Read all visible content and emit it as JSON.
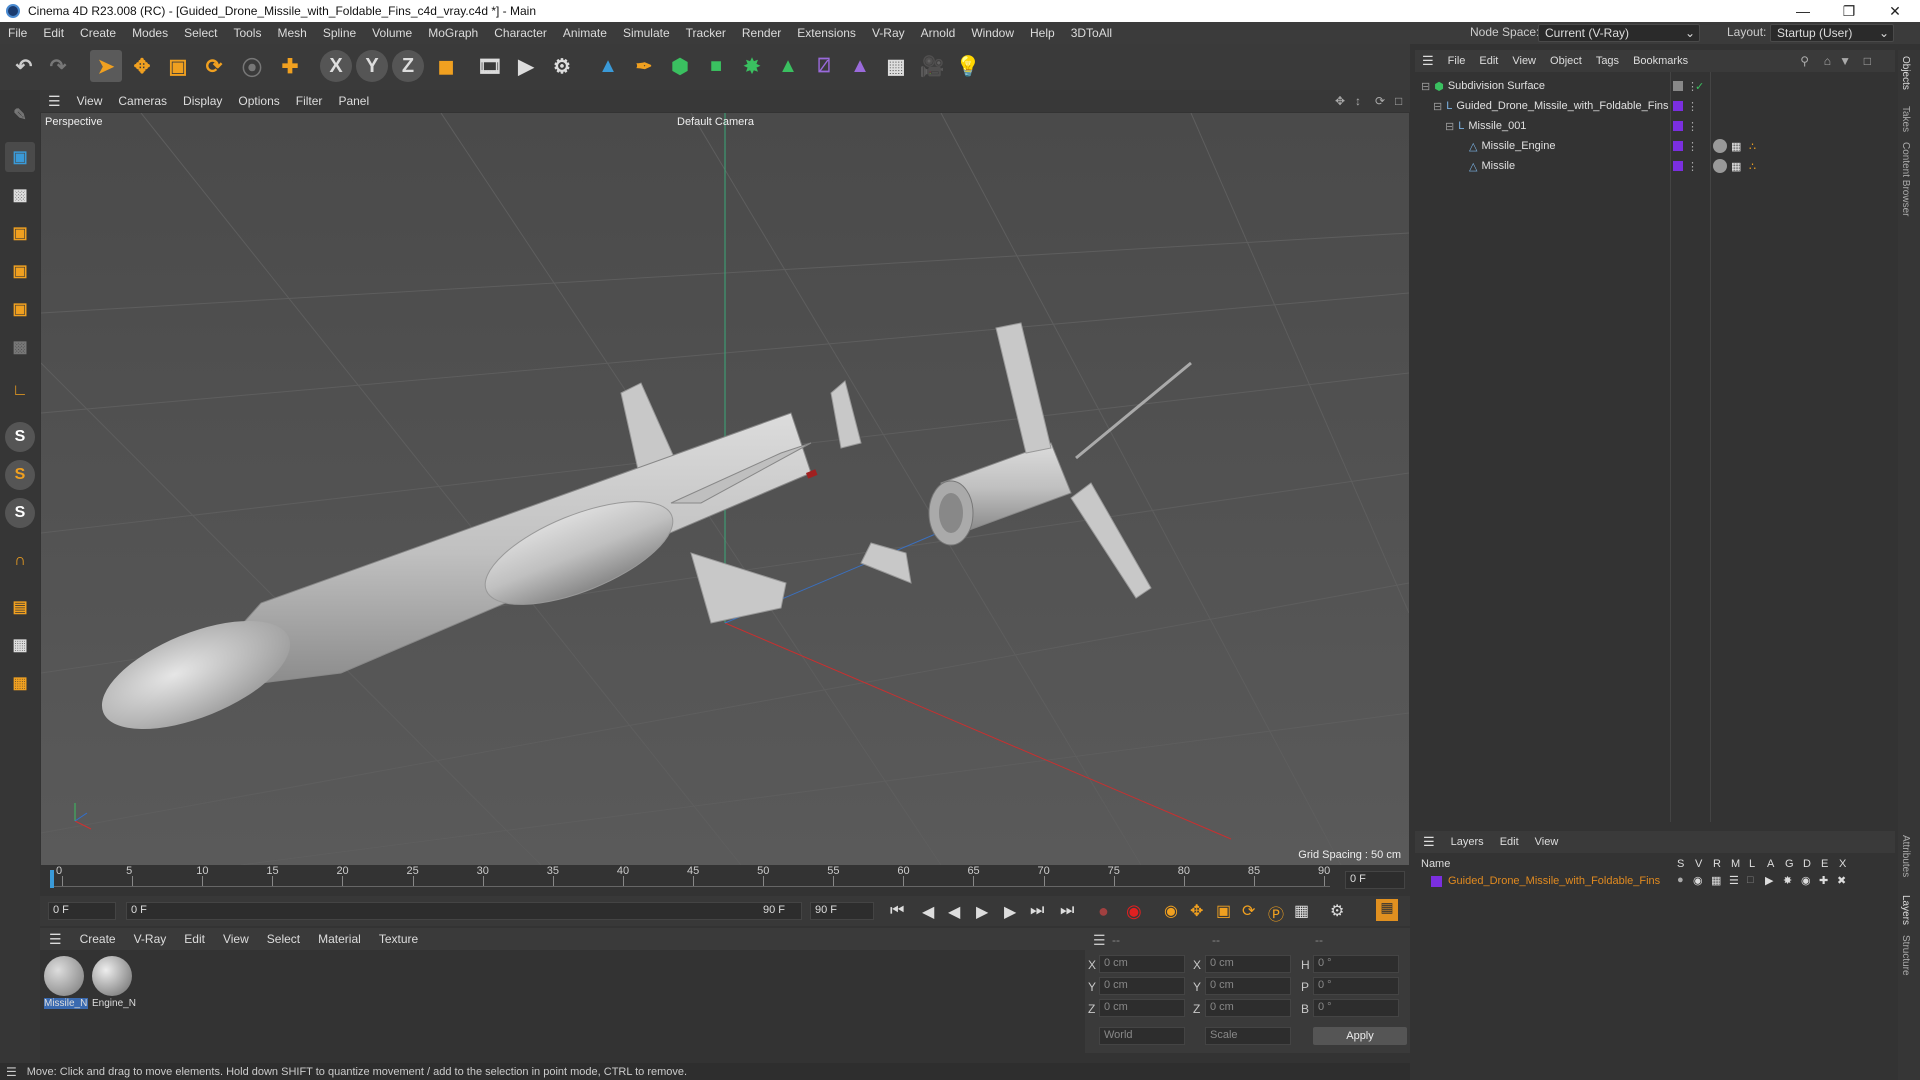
{
  "title": "Cinema 4D R23.008 (RC) - [Guided_Drone_Missile_with_Foldable_Fins_c4d_vray.c4d *] - Main",
  "menu": [
    "File",
    "Edit",
    "Create",
    "Modes",
    "Select",
    "Tools",
    "Mesh",
    "Spline",
    "Volume",
    "MoGraph",
    "Character",
    "Animate",
    "Simulate",
    "Tracker",
    "Render",
    "Extensions",
    "V-Ray",
    "Arnold",
    "Window",
    "Help",
    "3DToAll"
  ],
  "node_space_label": "Node Space:",
  "node_space_value": "Current (V-Ray)",
  "layout_label": "Layout:",
  "layout_value": "Startup (User)",
  "viewport_menu": [
    "View",
    "Cameras",
    "Display",
    "Options",
    "Filter",
    "Panel"
  ],
  "viewport": {
    "name": "Perspective",
    "camera": "Default Camera",
    "grid_spacing": "Grid Spacing : 50 cm"
  },
  "timeline": {
    "ticks": [
      "0",
      "5",
      "10",
      "15",
      "20",
      "25",
      "30",
      "35",
      "40",
      "45",
      "50",
      "55",
      "60",
      "65",
      "70",
      "75",
      "80",
      "85",
      "90"
    ],
    "current_frame": "0 F"
  },
  "transport": {
    "start": "0 F",
    "range_start": "0 F",
    "range_end": "90 F",
    "end": "90 F"
  },
  "material_menu": [
    "Create",
    "V-Ray",
    "Edit",
    "View",
    "Select",
    "Material",
    "Texture"
  ],
  "materials": [
    {
      "label": "Missile_N"
    },
    {
      "label": "Engine_N"
    }
  ],
  "coords": {
    "header": [
      "--",
      "--",
      "--"
    ],
    "rows": [
      {
        "a": "X",
        "av": "0 cm",
        "b": "X",
        "bv": "0 cm",
        "c": "H",
        "cv": "0 °"
      },
      {
        "a": "Y",
        "av": "0 cm",
        "b": "Y",
        "bv": "0 cm",
        "c": "P",
        "cv": "0 °"
      },
      {
        "a": "Z",
        "av": "0 cm",
        "b": "Z",
        "bv": "0 cm",
        "c": "B",
        "cv": "0 °"
      }
    ],
    "world": "World",
    "scale": "Scale",
    "apply": "Apply"
  },
  "status": "Move: Click and drag to move elements. Hold down SHIFT to quantize movement / add to the selection in point mode, CTRL to remove.",
  "object_menu": [
    "File",
    "Edit",
    "View",
    "Object",
    "Tags",
    "Bookmarks"
  ],
  "objects": [
    {
      "name": "Subdivision Surface",
      "indent": 0
    },
    {
      "name": "Guided_Drone_Missile_with_Foldable_Fins",
      "indent": 1
    },
    {
      "name": "Missile_001",
      "indent": 2
    },
    {
      "name": "Missile_Engine",
      "indent": 3
    },
    {
      "name": "Missile",
      "indent": 3
    }
  ],
  "layers_menu": [
    "Layers",
    "Edit",
    "View"
  ],
  "layers_header": {
    "name": "Name",
    "cols": [
      "S",
      "V",
      "R",
      "M",
      "L",
      "A",
      "G",
      "D",
      "E",
      "X"
    ]
  },
  "layer_row": "Guided_Drone_Missile_with_Foldable_Fins",
  "right_tabs": [
    "Objects",
    "Takes",
    "Content Browser",
    "Attributes",
    "Layers",
    "Structure"
  ],
  "colors": {
    "accent": "#e08a20",
    "purple": "#7b2fe0",
    "axis_x": "#d03030",
    "axis_y": "#30c060",
    "axis_z": "#3070d0"
  }
}
